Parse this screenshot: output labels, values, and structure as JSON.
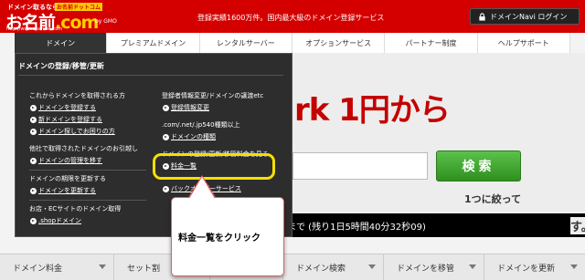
{
  "header": {
    "logo_tag": "ドメイン取るなら",
    "logo_tag2": "お名前ドットコム",
    "logo_main": "お名前",
    "logo_dot": ".com",
    "logo_url": "http://www.onamae.com",
    "logo_by": "by GMO",
    "tagline": "登録実績1600万件。国内最大級のドメイン登録サービス",
    "login_label": "ドメインNavi ログイン"
  },
  "nav": {
    "tabs": [
      "ドメイン",
      "プレミアムドメイン",
      "レンタルサーバー",
      "オプションサービス",
      "パートナー制度",
      "ヘルプサポート"
    ],
    "active_index": 0
  },
  "hero": {
    "headline": "rk 1円から",
    "search_button": "検索",
    "narrow_text": "1つに絞って",
    "countdown": "まで (残り1日5時間40分32秒09)",
    "suffix": "す。"
  },
  "dropdown": {
    "title": "ドメインの登録/移管/更新",
    "left": {
      "heading1": "これからドメインを取得される方",
      "links1": [
        "ドメインを登録する",
        "新ドメインを登録する",
        "ドメイン探しでお困りの方"
      ],
      "heading2": "他社で取得されたドメインのお引越し",
      "links2": [
        "ドメインの管理を移す"
      ],
      "heading3": "ドメインの期限を更新する",
      "links3": [
        "ドメインを更新する"
      ],
      "heading4": "お店・ECサイトのドメイン取得",
      "links4": [
        ".shopドメイン"
      ]
    },
    "right": {
      "heading1": "登録者情報変更/ドメインの譲渡etc",
      "links1": [
        "登録情報変更"
      ],
      "text1": ".com/.net/.jp540種類以上",
      "links2": [
        "ドメインの種類"
      ],
      "text2": "ドメインの登録/更新/移管料金を見る",
      "links3": [
        "料金一覧"
      ],
      "links4": [
        "バックオーダーサービス"
      ]
    }
  },
  "callout": {
    "text": "料金一覧をクリック",
    "highlight_color": "#f4e000",
    "border_color": "#e06060"
  },
  "bottom_tabs": [
    "ドメイン料金",
    "セット割",
    "",
    "ドメイン検索",
    "ドメインを移管",
    "ドメインを更新"
  ],
  "colors": {
    "brand_red": "#d40000",
    "nav_active": "#333333",
    "search_green": "#3aa52a",
    "dropdown_bg": "#2d2d2d"
  }
}
